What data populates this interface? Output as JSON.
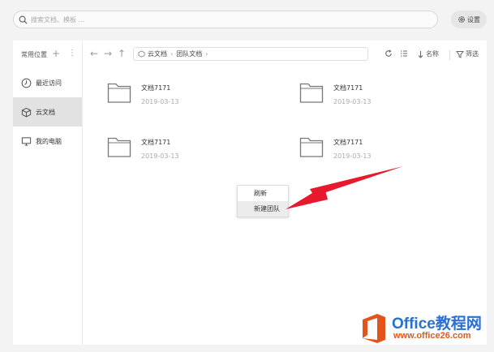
{
  "header": {
    "search_placeholder": "搜索文档、模板 ...",
    "settings_label": "设置"
  },
  "sidebar": {
    "heading": "常用位置",
    "plus_glyph": "+",
    "more_glyph": "⋮",
    "items": [
      {
        "label": "最近访问",
        "icon": "clock-icon"
      },
      {
        "label": "云文档",
        "icon": "cube-icon",
        "active": true
      },
      {
        "label": "我的电脑",
        "icon": "monitor-icon"
      }
    ]
  },
  "toolbar": {
    "back_glyph": "←",
    "forward_glyph": "→",
    "up_glyph": "↑",
    "breadcrumb": [
      "云文档",
      "团队文档"
    ],
    "sort_label": "名称",
    "filter_label": "筛选"
  },
  "files": [
    {
      "name": "文档7171",
      "date": "2019-03-13"
    },
    {
      "name": "文档7171",
      "date": "2019-03-13"
    },
    {
      "name": "文档7171",
      "date": "2019-03-13"
    },
    {
      "name": "文档7171",
      "date": "2019-03-13"
    }
  ],
  "context_menu": {
    "items": [
      "刷新",
      "新建团队"
    ],
    "hovered_index": 1
  },
  "watermark": {
    "title": "Office教程网",
    "url": "www.office26.com"
  },
  "colors": {
    "arrow": "#e8192c",
    "watermark_blue": "#2a6fd6",
    "watermark_orange": "#e05a1a"
  }
}
